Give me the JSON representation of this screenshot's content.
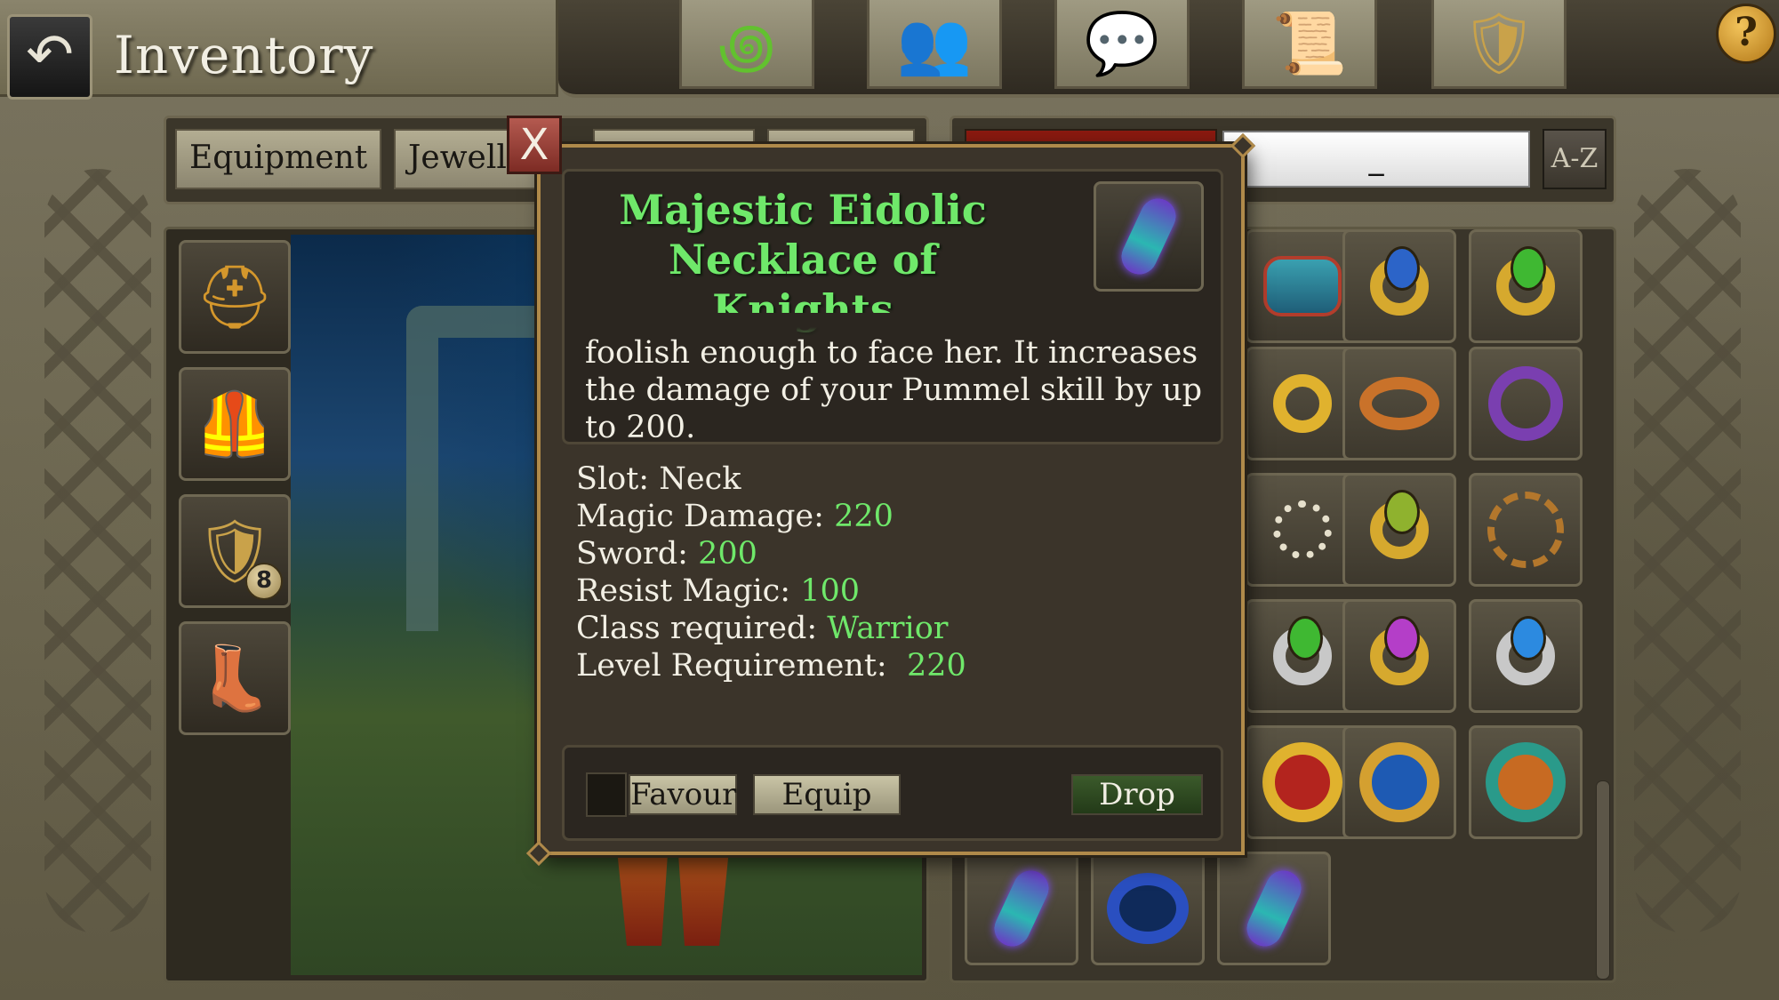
{
  "header": {
    "title": "Inventory",
    "nav_icons": [
      "spiral-icon",
      "party-icon",
      "chat-icon",
      "quest-scroll-icon",
      "guild-crest-icon"
    ],
    "help_label": "?"
  },
  "tabs": [
    {
      "label": "Equipment"
    },
    {
      "label": "Jewell"
    },
    {
      "label": ""
    },
    {
      "label": ""
    }
  ],
  "search": {
    "value": "_",
    "sort_label": "A-Z"
  },
  "equipment_slots": [
    {
      "name": "helmet-slot",
      "icon": "helmet-icon"
    },
    {
      "name": "chest-slot",
      "icon": "chest-armor-icon"
    },
    {
      "name": "shield-slot",
      "icon": "shield-icon",
      "badge": "8"
    },
    {
      "name": "boots-slot",
      "icon": "boots-icon"
    }
  ],
  "inventory_items": [
    {
      "icon": "bracelet-icon"
    },
    {
      "icon": "ring-blue-gem-icon"
    },
    {
      "icon": "ring-green-gem-icon"
    },
    {
      "icon": "ring-gold-band-icon"
    },
    {
      "icon": "ring-copper-band-icon"
    },
    {
      "icon": "ring-purple-icon"
    },
    {
      "icon": "bone-necklace-icon"
    },
    {
      "icon": "ring-green-gem-icon"
    },
    {
      "icon": "ring-braided-icon"
    },
    {
      "icon": "ring-green-silver-icon"
    },
    {
      "icon": "ring-purple-gem-icon"
    },
    {
      "icon": "ring-blue-silver-icon"
    },
    {
      "icon": "ring-ruby-icon"
    },
    {
      "icon": "ring-sapphire-icon"
    },
    {
      "icon": "ring-emerald-icon"
    },
    {
      "icon": "necklace-icon"
    },
    {
      "icon": "bracer-icon"
    },
    {
      "icon": "necklace-icon"
    }
  ],
  "popup": {
    "item_name": "Majestic Eidolic Necklace of Knights",
    "item_icon": "necklace-icon",
    "description": "foolish enough to face her. It increases the damage of your Pummel skill by up to 200.",
    "stats": [
      {
        "label": "Slot:",
        "value": "Neck"
      },
      {
        "label": "Magic Damage:",
        "value": "220"
      },
      {
        "label": "Sword:",
        "value": "200"
      },
      {
        "label": "Resist Magic:",
        "value": "100"
      },
      {
        "label": "Class required:",
        "value": "Warrior"
      },
      {
        "label": "Level Requirement:",
        "value": "220"
      }
    ],
    "actions": {
      "favour": "Favour",
      "equip": "Equip",
      "drop": "Drop"
    },
    "close_label": "X"
  },
  "colors": {
    "item_name": "#6fe86a",
    "stat_value": "#6fe86a",
    "popup_border": "#b08a4a",
    "close_button": "#9b3b33"
  }
}
